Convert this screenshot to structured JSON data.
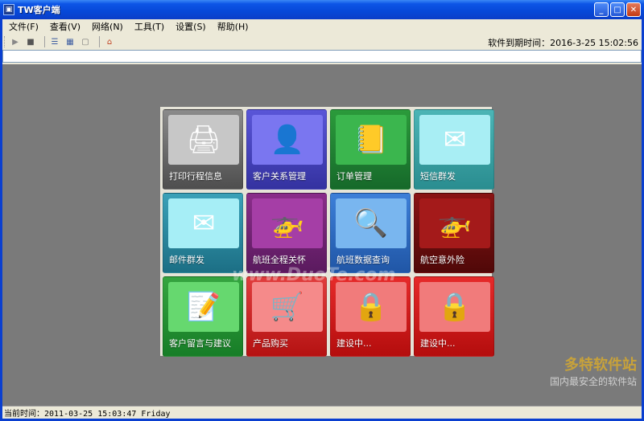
{
  "window": {
    "title": "TW客户端"
  },
  "menu": [
    {
      "label": "文件(F)"
    },
    {
      "label": "查看(V)"
    },
    {
      "label": "网络(N)"
    },
    {
      "label": "工具(T)"
    },
    {
      "label": "设置(S)"
    },
    {
      "label": "帮助(H)"
    }
  ],
  "toolbar": {
    "icons": [
      "play-icon",
      "stop-icon",
      "list-icon",
      "grid-icon",
      "blank-page-icon",
      "home-refresh-icon"
    ],
    "expire_text": "软件到期时间：2016-3-25 15:02:56"
  },
  "tiles": [
    {
      "label": "打印行程信息",
      "icon": "printer-icon",
      "color": "#8b8b8b"
    },
    {
      "label": "客户关系管理",
      "icon": "businessman-icon",
      "color": "#5a56d8"
    },
    {
      "label": "订单管理",
      "icon": "notebook-icon",
      "color": "#2b9b3b"
    },
    {
      "label": "短信群发",
      "icon": "envelope-icon",
      "color": "#4cb5b6"
    },
    {
      "label": "邮件群发",
      "icon": "envelope-icon",
      "color": "#3aa1b8"
    },
    {
      "label": "航班全程关怀",
      "icon": "helicopter-icon",
      "color": "#8a2d8a"
    },
    {
      "label": "航班数据查询",
      "icon": "globe-magnifier-icon",
      "color": "#3d7fd8"
    },
    {
      "label": "航空意外险",
      "icon": "helicopter-icon",
      "color": "#8a1414"
    },
    {
      "label": "客户留言与建议",
      "icon": "document-pen-icon",
      "color": "#35a540"
    },
    {
      "label": "产品购买",
      "icon": "shopping-cart-icon",
      "color": "#e03d3d"
    },
    {
      "label": "建设中...",
      "icon": "lock-icon",
      "color": "#e62a2a"
    },
    {
      "label": "建设中...",
      "icon": "lock-icon",
      "color": "#e62a2a"
    }
  ],
  "status": {
    "text": "当前时间：2011-03-25 15:03:47 Friday"
  },
  "watermark": {
    "main": "多特软件站",
    "sub": "国内最安全的软件站",
    "center": "www.DuoTe.com"
  }
}
